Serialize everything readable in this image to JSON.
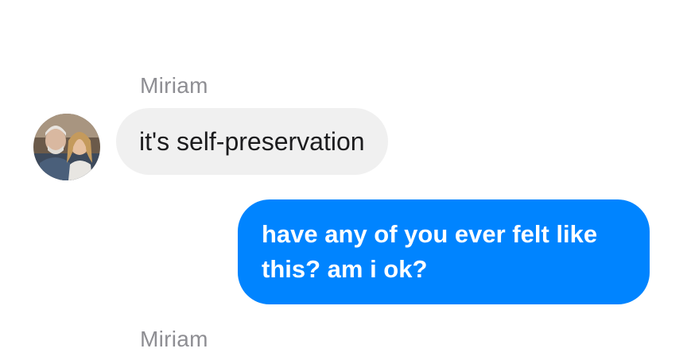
{
  "messages": [
    {
      "sender": "Miriam",
      "direction": "incoming",
      "text": "it's self-preservation",
      "avatar_icon": "contact-photo-avatar"
    },
    {
      "sender": "",
      "direction": "outgoing",
      "text": "have any of you ever felt like this? am i ok?"
    }
  ],
  "next_sender": "Miriam",
  "colors": {
    "incoming_bubble": "#f0f0f0",
    "outgoing_bubble": "#0084ff",
    "sender_name": "#8e8e93"
  }
}
